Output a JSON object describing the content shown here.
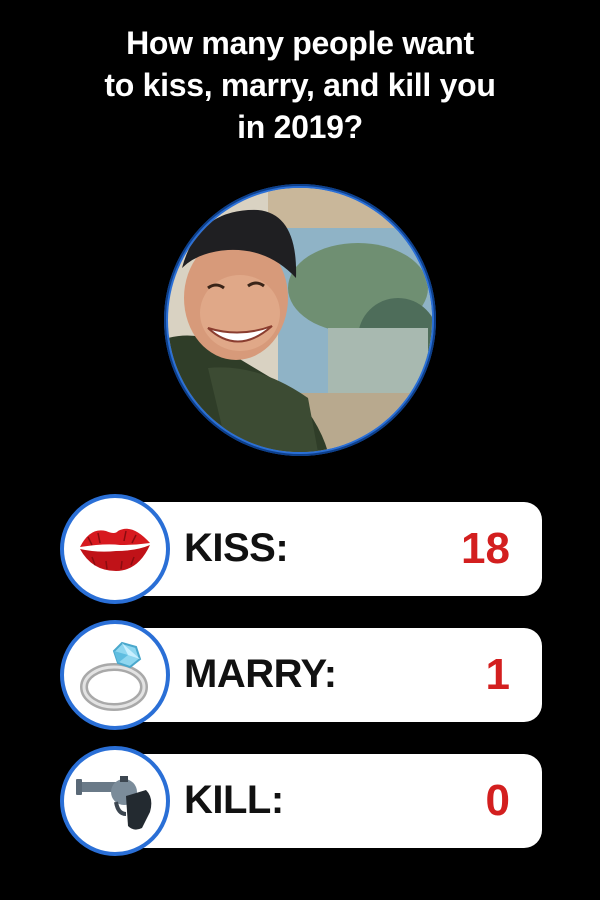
{
  "question": {
    "line1": "How many people want",
    "line2": "to kiss, marry, and kill you",
    "line3": "in 2019?"
  },
  "photo": {
    "icon": "profile-photo"
  },
  "results": [
    {
      "label": "KISS:",
      "count": "18",
      "icon": "kiss-lips-icon"
    },
    {
      "label": "MARRY:",
      "count": "1",
      "icon": "ring-icon"
    },
    {
      "label": "KILL:",
      "count": "0",
      "icon": "pistol-icon"
    }
  ],
  "colors": {
    "background": "#000000",
    "accent_ring": "#2a6fd6",
    "count_text": "#d31f1f"
  }
}
